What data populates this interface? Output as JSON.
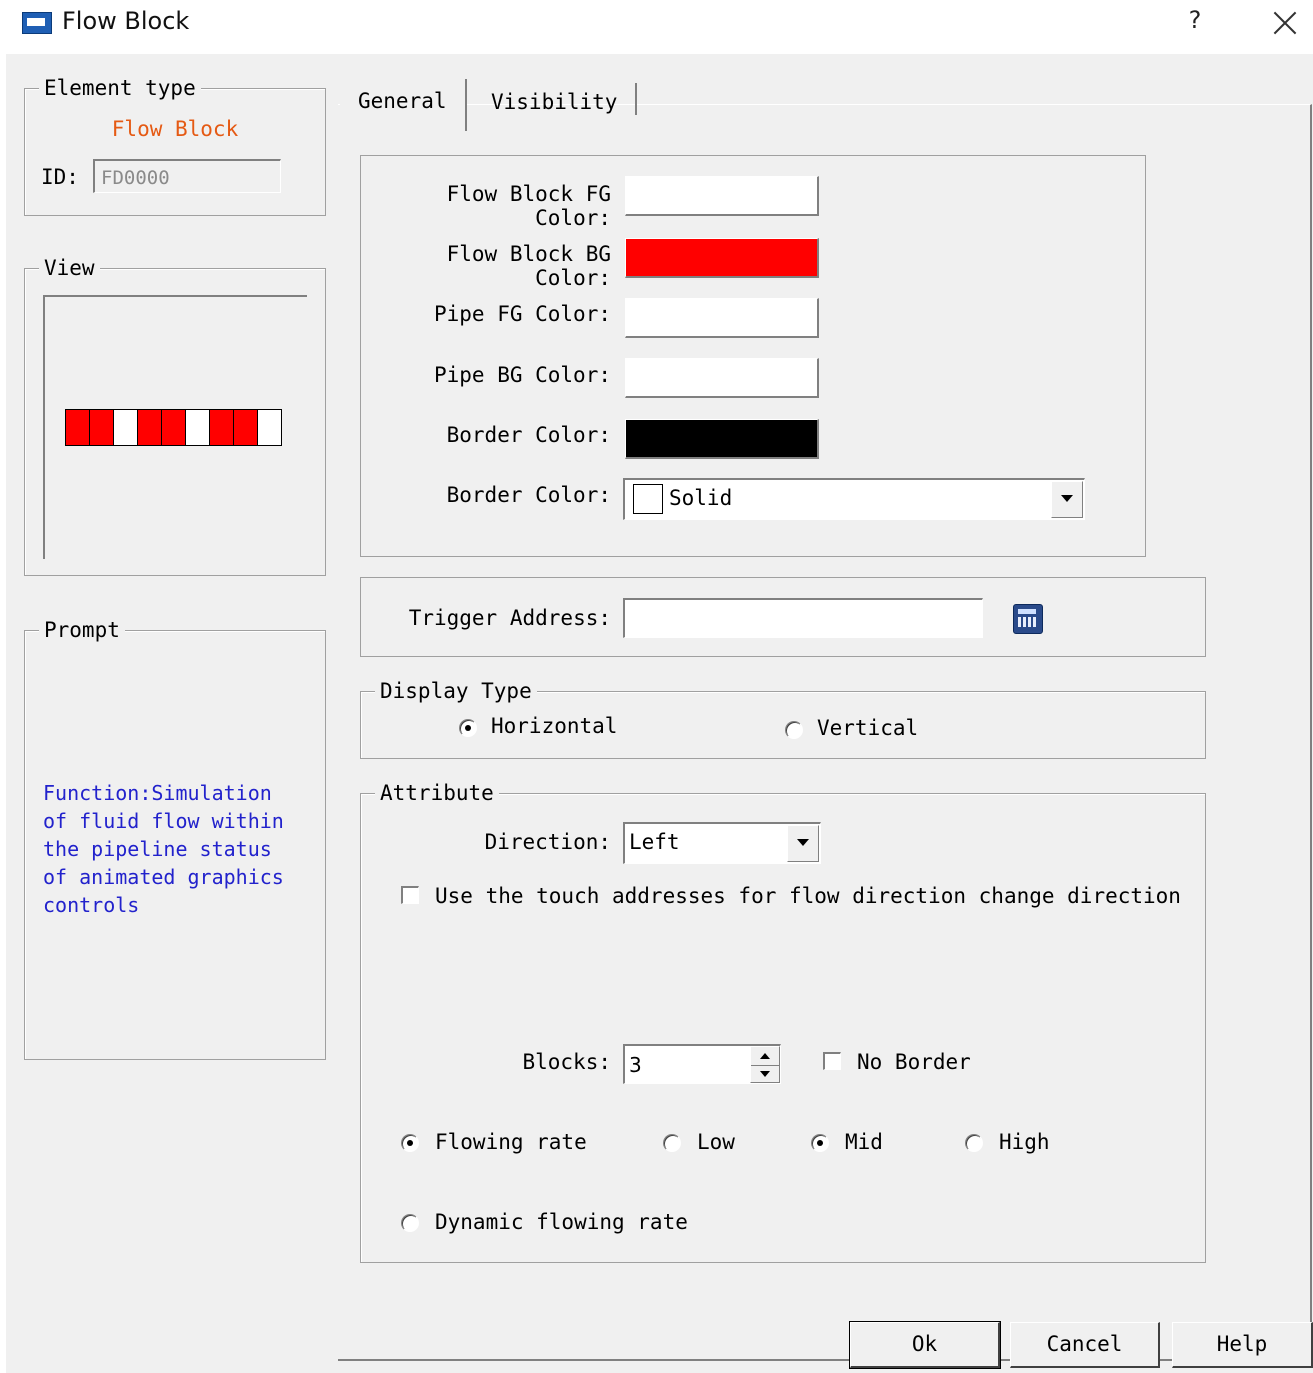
{
  "window": {
    "title": "Flow Block",
    "help_label": "?"
  },
  "element_type": {
    "legend": "Element type",
    "name": "Flow Block",
    "id_label": "ID:",
    "id_value": "FD0000",
    "name_color": "#e55a14"
  },
  "view": {
    "legend": "View",
    "blocks": [
      "red",
      "red",
      "white",
      "red",
      "red",
      "white",
      "red",
      "red",
      "white"
    ],
    "block_colors": {
      "red": "#ff0000",
      "white": "#ffffff"
    }
  },
  "prompt": {
    "legend": "Prompt",
    "text": "Function:Simulation of fluid flow within the pipeline status of animated graphics controls"
  },
  "tabs": [
    {
      "label": "General",
      "active": true
    },
    {
      "label": "Visibility",
      "active": false
    }
  ],
  "colors": {
    "flow_block_fg": {
      "label": "Flow Block FG Color:",
      "value": "#ffffff"
    },
    "flow_block_bg": {
      "label": "Flow Block BG Color:",
      "value": "#ff0000"
    },
    "pipe_fg": {
      "label": "Pipe FG Color:",
      "value": "#ffffff"
    },
    "pipe_bg": {
      "label": "Pipe BG Color:",
      "value": "#ffffff"
    },
    "border_color": {
      "label": "Border Color:",
      "value": "#000000"
    },
    "border_style": {
      "label": "Border Color:",
      "value": "Solid"
    }
  },
  "trigger": {
    "label": "Trigger Address:",
    "value": "",
    "icon": "calculator-icon"
  },
  "display_type": {
    "legend": "Display Type",
    "horizontal": {
      "label": "Horizontal",
      "checked": true
    },
    "vertical": {
      "label": "Vertical",
      "checked": false
    }
  },
  "attribute": {
    "legend": "Attribute",
    "direction_label": "Direction:",
    "direction_value": "Left",
    "touch_label": "Use the touch addresses for flow direction change direction",
    "touch_checked": false,
    "blocks_label": "Blocks:",
    "blocks_value": "3",
    "no_border_label": "No Border",
    "no_border_checked": false,
    "flowing_rate": {
      "label": "Flowing rate",
      "checked": true
    },
    "low": {
      "label": "Low",
      "checked": false
    },
    "mid": {
      "label": "Mid",
      "checked": true
    },
    "high": {
      "label": "High",
      "checked": false
    },
    "dynamic": {
      "label": "Dynamic flowing rate",
      "checked": false
    }
  },
  "buttons": {
    "ok": "Ok",
    "cancel": "Cancel",
    "help": "Help"
  }
}
